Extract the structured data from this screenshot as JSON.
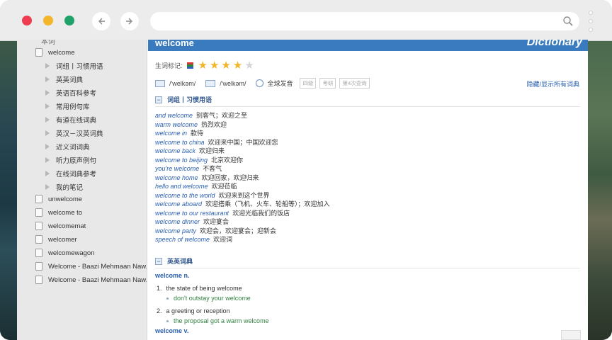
{
  "browser": {
    "url_value": "",
    "back_icon": "arrow-left-icon",
    "forward_icon": "arrow-right-icon"
  },
  "sidebar": {
    "top_partial": "本词",
    "items": [
      {
        "label": "welcome",
        "type": "doc",
        "level": 1
      },
      {
        "label": "词组丨习惯用语",
        "type": "sub",
        "level": 2
      },
      {
        "label": "英英词典",
        "type": "sub",
        "level": 2
      },
      {
        "label": "英语百科参考",
        "type": "sub",
        "level": 2
      },
      {
        "label": "常用例句库",
        "type": "sub",
        "level": 2
      },
      {
        "label": "有道在线词典",
        "type": "sub",
        "level": 2
      },
      {
        "label": "英汉－汉英词典",
        "type": "sub",
        "level": 2
      },
      {
        "label": "近义词词典",
        "type": "sub",
        "level": 2
      },
      {
        "label": "听力原声例句",
        "type": "sub",
        "level": 2
      },
      {
        "label": "在线词典参考",
        "type": "sub",
        "level": 2
      },
      {
        "label": "我的笔记",
        "type": "sub",
        "level": 2
      },
      {
        "label": "unwelcome",
        "type": "doc",
        "level": 1
      },
      {
        "label": "welcome to",
        "type": "doc",
        "level": 1
      },
      {
        "label": "welcomemat",
        "type": "doc",
        "level": 1
      },
      {
        "label": "welcomer",
        "type": "doc",
        "level": 1
      },
      {
        "label": "welcomewagon",
        "type": "doc",
        "level": 1
      },
      {
        "label": "Welcome - Baazi Mehmaan Naw...",
        "type": "doc",
        "level": 1
      },
      {
        "label": "Welcome - Baazi Mehmaan Naw...",
        "type": "doc",
        "level": 1
      }
    ]
  },
  "content": {
    "header_word": "welcome",
    "brand": "Dictionary",
    "wordbook_label": "生词标记:",
    "stars_filled": 4,
    "stars_total": 5,
    "pron_uk": "/'welkəm/",
    "pron_us": "/'welkəm/",
    "global_pron": "全球发音",
    "tags": [
      "四级",
      "考研",
      "第4次查询"
    ],
    "toggle_all": "隐藏/显示所有词典",
    "phrases_section": "词组丨习惯用语",
    "phrases": [
      {
        "en": "and welcome",
        "zh": "别客气；欢迎之至"
      },
      {
        "en": "warm welcome",
        "zh": "热烈欢迎"
      },
      {
        "en": "welcome in",
        "zh": "款待"
      },
      {
        "en": "welcome to china",
        "zh": "欢迎来中国；中国欢迎您"
      },
      {
        "en": "welcome back",
        "zh": "欢迎归来"
      },
      {
        "en": "welcome to beijing",
        "zh": "北京欢迎你"
      },
      {
        "en": "you're welcome",
        "zh": "不客气"
      },
      {
        "en": "welcome home",
        "zh": "欢迎回家，欢迎归来"
      },
      {
        "en": "hello and welcome",
        "zh": "欢迎莅临"
      },
      {
        "en": "welcome to the world",
        "zh": "欢迎来到这个世界"
      },
      {
        "en": "welcome aboard",
        "zh": "欢迎搭乘（飞机、火车、轮船等）；欢迎加入"
      },
      {
        "en": "welcome to our restaurant",
        "zh": "欢迎光临我们的饭店"
      },
      {
        "en": "welcome dinner",
        "zh": "欢迎宴会"
      },
      {
        "en": "welcome party",
        "zh": "欢迎会，欢迎宴会；迎新会"
      },
      {
        "en": "speech of welcome",
        "zh": "欢迎词"
      }
    ],
    "ee_section": "英英词典",
    "ee_pos1": "welcome n.",
    "ee_defs": [
      {
        "num": "1.",
        "text": "the state of being welcome",
        "example": "don't outstay your welcome"
      },
      {
        "num": "2.",
        "text": "a greeting or reception",
        "example": "the proposal got a warm welcome"
      }
    ],
    "ee_pos2": "welcome v."
  },
  "colors": {
    "header_blue": "#3a7bbf",
    "link_blue": "#2a5fb0",
    "example_green": "#2f7f3f",
    "star_gold": "#f0b62a",
    "close": "#ee3d50",
    "minimize": "#f3b52a",
    "maximize": "#1fa16a"
  }
}
